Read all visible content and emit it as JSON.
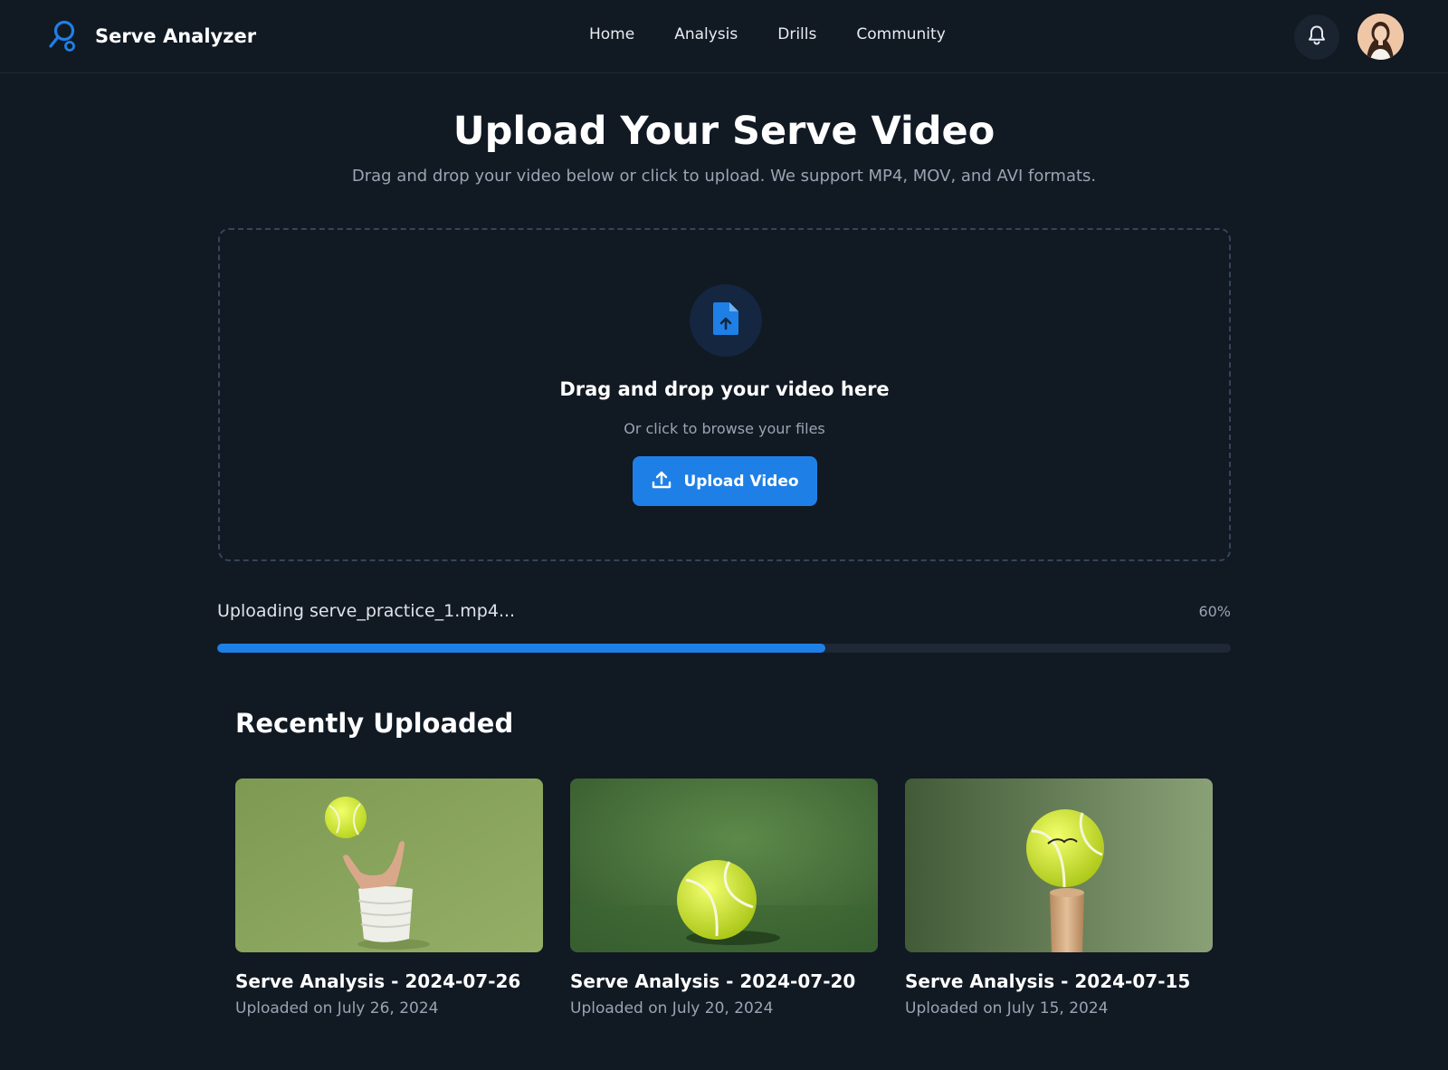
{
  "app": {
    "name": "Serve Analyzer"
  },
  "nav": {
    "items": [
      "Home",
      "Analysis",
      "Drills",
      "Community"
    ]
  },
  "header": {
    "bell_icon": "bell-icon",
    "avatar": "user-avatar"
  },
  "hero": {
    "title": "Upload Your Serve Video",
    "subtitle": "Drag and drop your video below or click to upload. We support MP4, MOV, and AVI formats."
  },
  "dropzone": {
    "icon": "file-upload-icon",
    "title": "Drag and drop your video here",
    "subtitle": "Or click to browse your files",
    "button_label": "Upload Video",
    "button_icon": "upload-icon"
  },
  "progress": {
    "label": "Uploading serve_practice_1.mp4...",
    "percent_text": "60%",
    "value": 0.6
  },
  "recent": {
    "title": "Recently Uploaded",
    "items": [
      {
        "title": "Serve Analysis - 2024-07-26",
        "date": "Uploaded on July 26, 2024",
        "thumb": "hand-tossing-tennis-ball"
      },
      {
        "title": "Serve Analysis - 2024-07-20",
        "date": "Uploaded on July 20, 2024",
        "thumb": "tennis-ball-on-court"
      },
      {
        "title": "Serve Analysis - 2024-07-15",
        "date": "Uploaded on July 15, 2024",
        "thumb": "tennis-ball-on-stand"
      }
    ]
  },
  "colors": {
    "background": "#111923",
    "accent": "#1e80e6",
    "muted_text": "#9aa4b2",
    "track": "#1e2836"
  }
}
